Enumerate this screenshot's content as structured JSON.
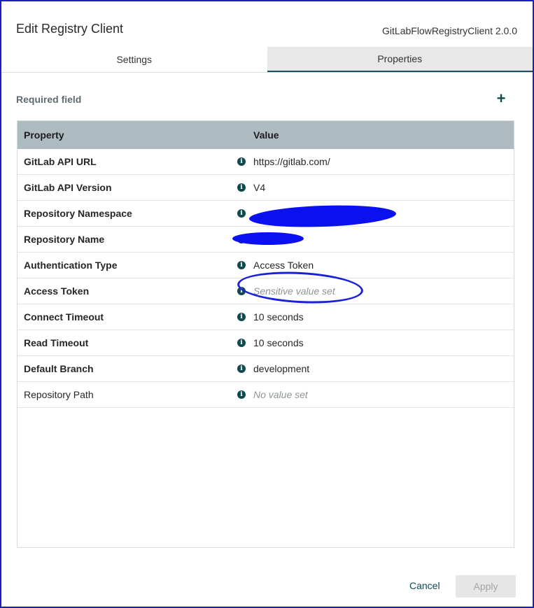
{
  "dialog": {
    "title": "Edit Registry Client",
    "subtitle": "GitLabFlowRegistryClient 2.0.0"
  },
  "tabs": [
    {
      "label": "Settings",
      "active": true
    },
    {
      "label": "Properties",
      "active": false
    }
  ],
  "required_label": "Required field",
  "add_icon": "plus-icon",
  "table": {
    "headers": {
      "property": "Property",
      "value": "Value"
    },
    "rows": [
      {
        "property": "GitLab API URL",
        "value": "https://gitlab.com/"
      },
      {
        "property": "GitLab API Version",
        "value": "V4"
      },
      {
        "property": "Repository Namespace",
        "value": ""
      },
      {
        "property": "Repository Name",
        "value": ""
      },
      {
        "property": "Authentication Type",
        "value": "Access Token"
      },
      {
        "property": "Access Token",
        "value": "Sensitive value set"
      },
      {
        "property": "Connect Timeout",
        "value": "10 seconds"
      },
      {
        "property": "Read Timeout",
        "value": "10 seconds"
      },
      {
        "property": "Default Branch",
        "value": "development"
      },
      {
        "property": "Repository Path",
        "value": "No value set"
      }
    ]
  },
  "footer": {
    "cancel_label": "Cancel",
    "apply_label": "Apply"
  },
  "colors": {
    "accent": "#0f4a4e",
    "header_bg": "#aebbc1",
    "annotation": "#1a22d8"
  }
}
